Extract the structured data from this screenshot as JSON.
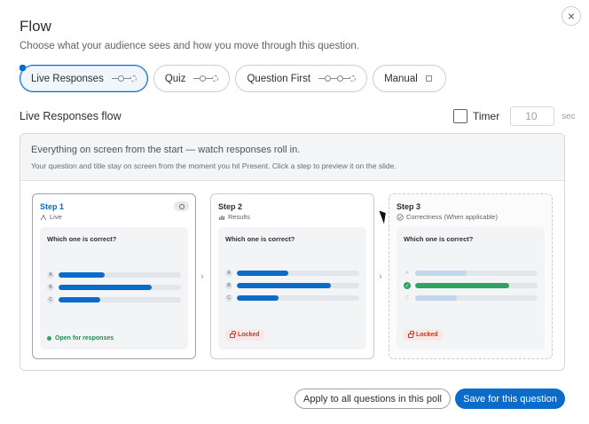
{
  "dialog": {
    "title": "Flow",
    "subtitle": "Choose what your audience sees and how you move through this question.",
    "close_icon": "×"
  },
  "modes": [
    {
      "label": "Live Responses",
      "active": true
    },
    {
      "label": "Quiz",
      "active": false
    },
    {
      "label": "Question First",
      "active": false
    },
    {
      "label": "Manual",
      "active": false
    }
  ],
  "flow": {
    "section_title": "Live Responses flow",
    "timer_label": "Timer",
    "timer_value": "10",
    "timer_unit": "sec",
    "timer_checked": false,
    "description": "Everything on screen from the start — watch responses roll in.",
    "hint": "Your question and title stay on screen from the moment you hit Present. Click a step to preview it on the slide."
  },
  "steps": [
    {
      "name": "Step 1",
      "subtitle": "Live",
      "question": "Which one is correct?",
      "options": [
        {
          "letter": "A",
          "fraction": 0.38
        },
        {
          "letter": "B",
          "fraction": 0.76
        },
        {
          "letter": "C",
          "fraction": 0.34
        }
      ],
      "status": "Open for responses"
    },
    {
      "name": "Step 2",
      "subtitle": "Results",
      "question": "Which one is correct?",
      "options": [
        {
          "letter": "A",
          "fraction": 0.42
        },
        {
          "letter": "B",
          "fraction": 0.77
        },
        {
          "letter": "C",
          "fraction": 0.34
        }
      ],
      "status": "Locked"
    },
    {
      "name": "Step 3",
      "subtitle": "Correctness (When applicable)",
      "question": "Which one is correct?",
      "options": [
        {
          "letter": "A",
          "fraction": 0.42
        },
        {
          "letter": "B",
          "fraction": 0.77
        },
        {
          "letter": "C",
          "fraction": 0.34
        }
      ],
      "correct_index": 1,
      "status": "Locked"
    }
  ],
  "footer": {
    "apply_all_label": "Apply to all questions in this poll",
    "save_label": "Save for this question"
  },
  "colors": {
    "accent": "#0a6cc8",
    "correct": "#2fa365",
    "locked": "#c0392b"
  }
}
